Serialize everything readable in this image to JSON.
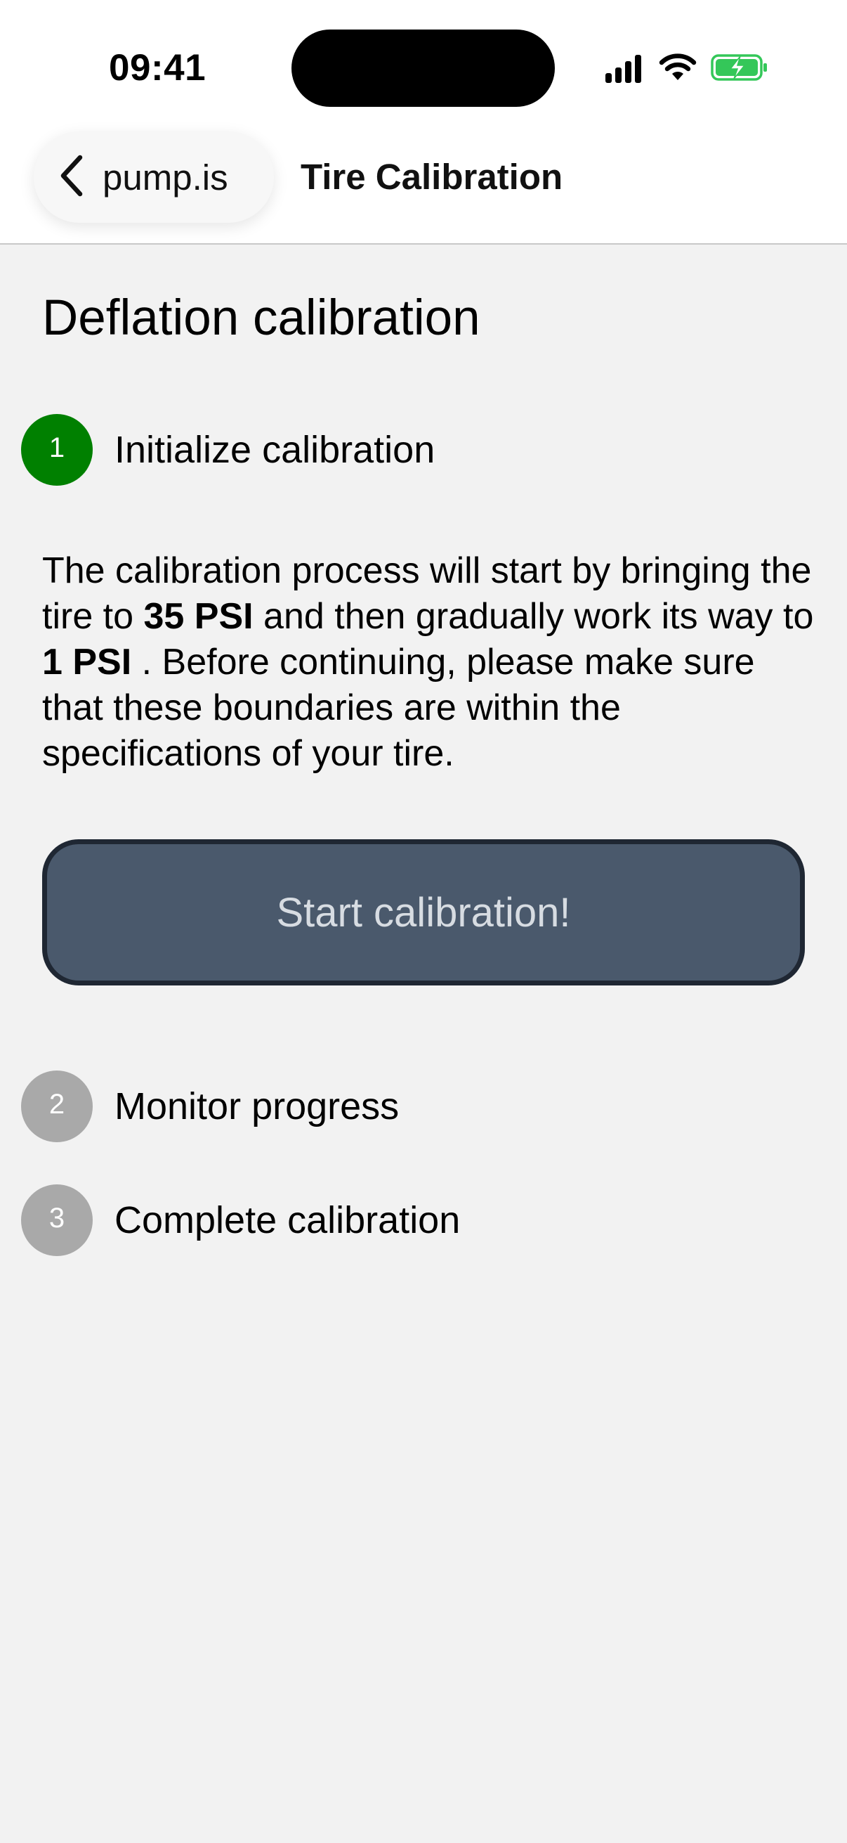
{
  "status_bar": {
    "time": "09:41"
  },
  "nav": {
    "back_label": "pump.is",
    "title": "Tire Calibration"
  },
  "page": {
    "title": "Deflation calibration"
  },
  "steps": [
    {
      "number": "1",
      "label": "Initialize calibration",
      "color": "#008000"
    },
    {
      "number": "2",
      "label": "Monitor progress",
      "color": "#a9a9a9"
    },
    {
      "number": "3",
      "label": "Complete calibration",
      "color": "#a9a9a9"
    }
  ],
  "description": {
    "part1": "The calibration process will start by bringing the tire to ",
    "start_pressure": "35 PSI",
    "part2": " and then gradually work its way to ",
    "end_pressure": "1 PSI",
    "part3": " . Before continuing, please make sure that these boundaries are within the specifications of your tire."
  },
  "start_button": {
    "label": "Start calibration!",
    "background": "#4a596c"
  },
  "icons": [
    "chevron-left-icon",
    "signal-icon",
    "wifi-icon",
    "battery-charging-icon"
  ]
}
